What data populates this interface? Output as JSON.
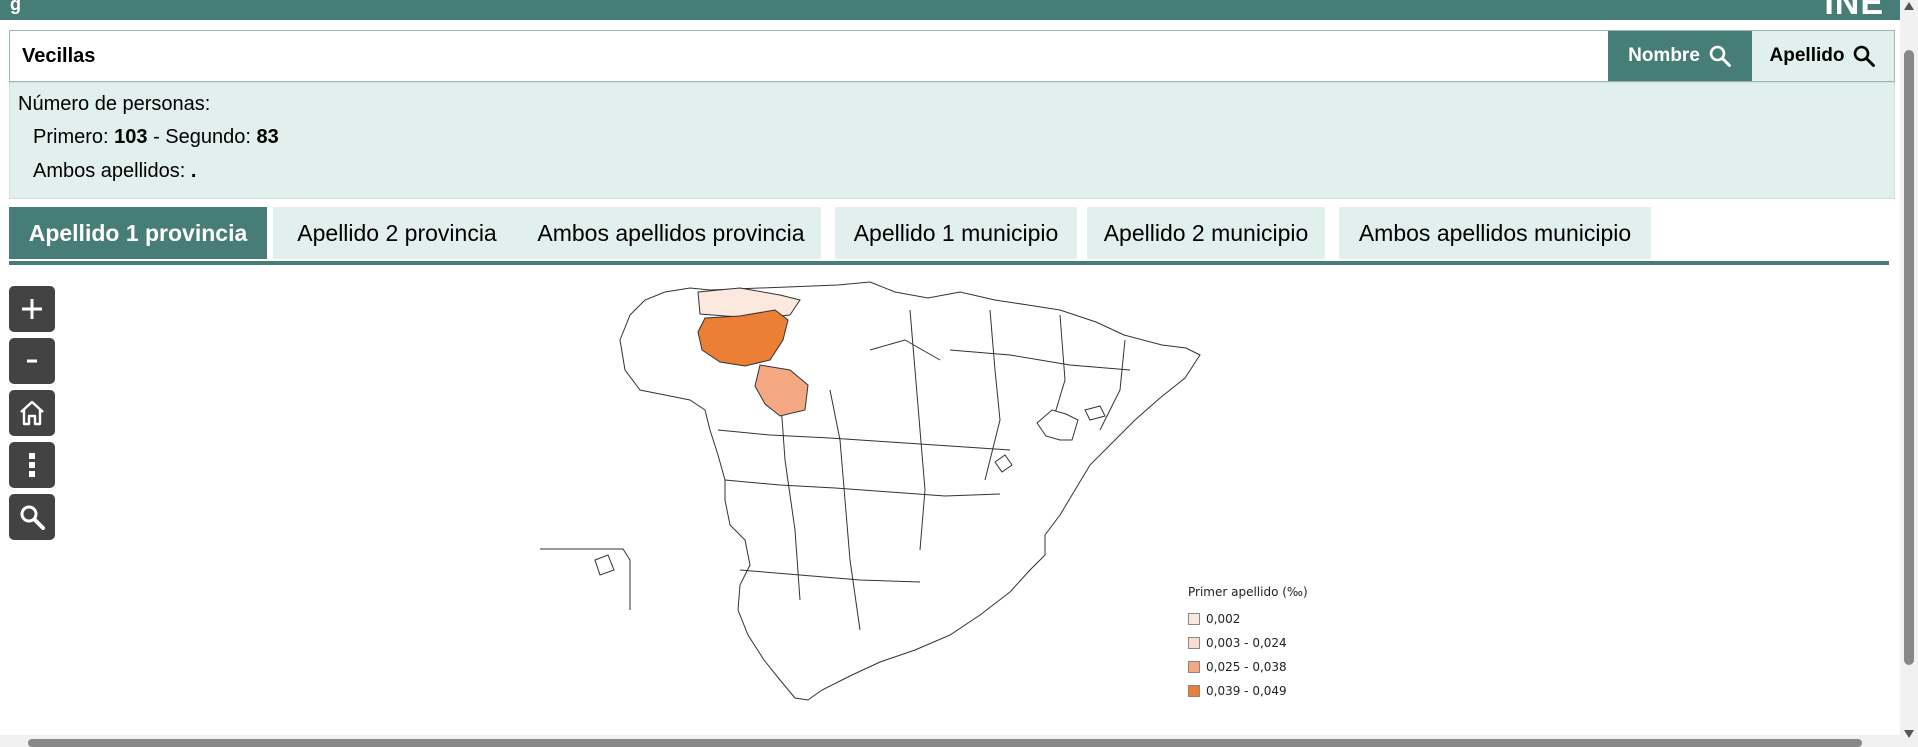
{
  "header": {
    "left_glyph": "g",
    "brand": "INE"
  },
  "search": {
    "value": "Vecillas",
    "nombre_button": "Nombre",
    "apellido_button": "Apellido"
  },
  "info": {
    "title": "Número de personas:",
    "primero_label": "Primero:",
    "primero_value": "103",
    "sep": " - ",
    "segundo_label": "Segundo:",
    "segundo_value": "83",
    "ambos_label": "Ambos apellidos:",
    "ambos_value": "."
  },
  "tabs": [
    {
      "label": "Apellido 1 provincia",
      "active": true
    },
    {
      "label": "Apellido 2 provincia",
      "active": false
    },
    {
      "label": "Ambos apellidos provincia",
      "active": false
    },
    {
      "label": "Apellido 1 municipio",
      "active": false
    },
    {
      "label": "Apellido 2 municipio",
      "active": false
    },
    {
      "label": "Ambos apellidos municipio",
      "active": false
    }
  ],
  "map_controls": [
    "zoom-in-icon",
    "zoom-out-icon",
    "home-icon",
    "more-vertical-icon",
    "search-icon"
  ],
  "legend": {
    "title": "Primer apellido (‰)",
    "items": [
      {
        "label": "0,002",
        "color": "#fbe8df"
      },
      {
        "label": "0,003 - 0,024",
        "color": "#f9ddd0"
      },
      {
        "label": "0,025 - 0,038",
        "color": "#f4a983"
      },
      {
        "label": "0,039 - 0,049",
        "color": "#ec7f36"
      }
    ]
  },
  "colors": {
    "accent": "#467d77",
    "light": "#e1efed"
  }
}
